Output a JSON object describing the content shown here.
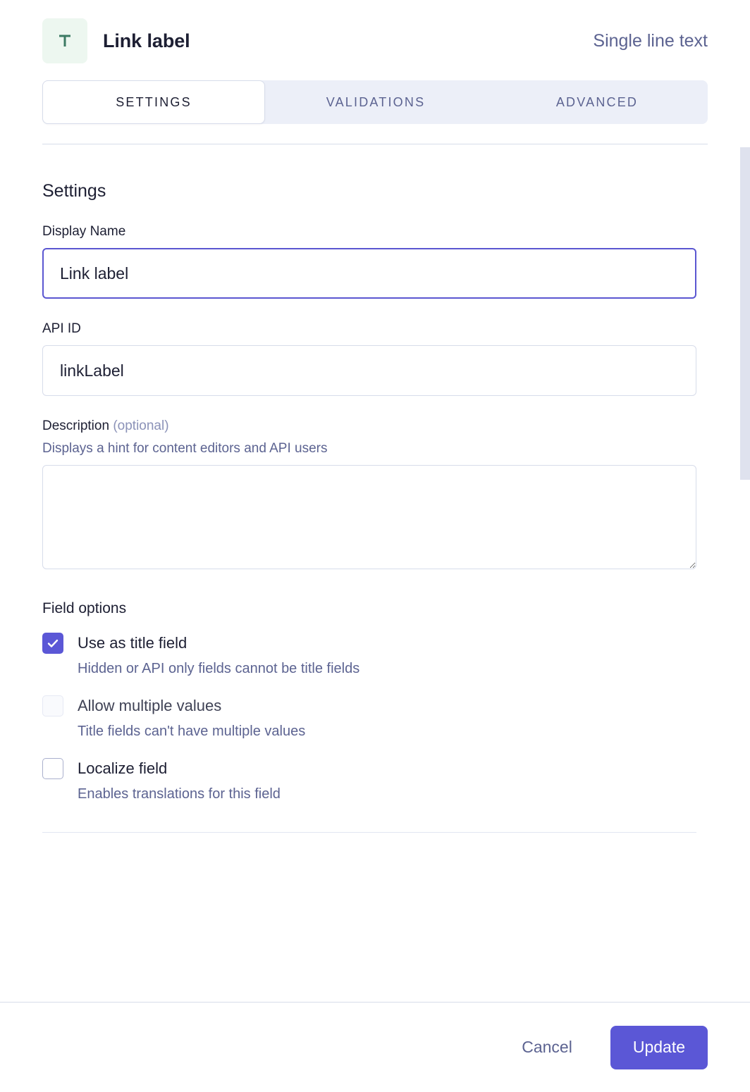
{
  "header": {
    "icon": "single-line-text-icon",
    "icon_glyph": "T",
    "title": "Link label",
    "field_type": "Single line text",
    "icon_bg": "#edf7f0",
    "icon_color": "#3c7a63"
  },
  "tabs": [
    {
      "label": "SETTINGS",
      "active": true
    },
    {
      "label": "VALIDATIONS",
      "active": false
    },
    {
      "label": "ADVANCED",
      "active": false
    }
  ],
  "settings": {
    "section_title": "Settings",
    "display_name": {
      "label": "Display Name",
      "value": "Link label",
      "placeholder": ""
    },
    "api_id": {
      "label": "API ID",
      "value": "linkLabel",
      "placeholder": ""
    },
    "description": {
      "label": "Description",
      "optional": "(optional)",
      "hint": "Displays a hint for content editors and API users",
      "value": "",
      "placeholder": ""
    },
    "field_options": {
      "title": "Field options",
      "items": [
        {
          "label": "Use as title field",
          "description": "Hidden or API only fields cannot be title fields",
          "checked": true,
          "disabled": false
        },
        {
          "label": "Allow multiple values",
          "description": "Title fields can't have multiple values",
          "checked": false,
          "disabled": true
        },
        {
          "label": "Localize field",
          "description": "Enables translations for this field",
          "checked": false,
          "disabled": false
        }
      ]
    }
  },
  "footer": {
    "cancel_label": "Cancel",
    "update_label": "Update"
  },
  "colors": {
    "accent": "#5b57d6",
    "focus_border": "#5b57d1",
    "muted_text": "#5c6391",
    "border": "#d7dcea",
    "tab_bg": "#eceff8"
  }
}
